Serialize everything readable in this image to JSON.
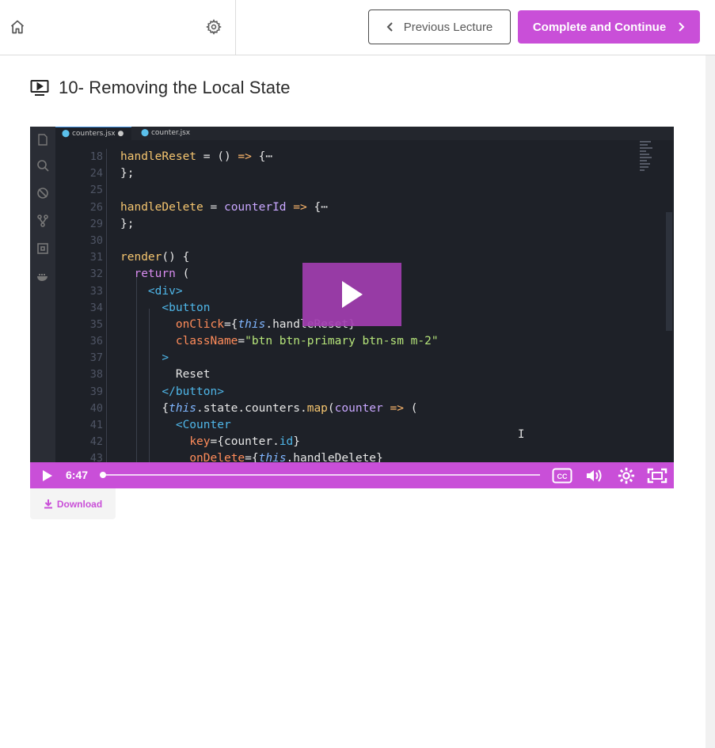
{
  "header": {
    "home_icon": "home-icon",
    "settings_icon": "gear-icon",
    "previous_label": "Previous Lecture",
    "complete_label": "Complete and Continue"
  },
  "lecture": {
    "title": "10- Removing the Local State",
    "title_icon": "video-lecture-icon"
  },
  "video": {
    "editor_tabs": [
      "counters.jsx",
      "counter.jsx"
    ],
    "line_numbers": [
      "18",
      "24",
      "25",
      "26",
      "29",
      "30",
      "31",
      "32",
      "33",
      "34",
      "35",
      "36",
      "37",
      "38",
      "39",
      "40",
      "41",
      "42",
      "43"
    ],
    "current_time": "6:47",
    "progress": 0.0,
    "controls": {
      "play_icon": "play-icon",
      "captions_icon": "cc-icon",
      "volume_icon": "volume-icon",
      "settings_icon": "settings-icon",
      "fullscreen_icon": "fullscreen-icon"
    }
  },
  "download": {
    "label": "Download",
    "icon": "download-icon"
  },
  "colors": {
    "accent": "#c94fd8",
    "play_overlay": "#a23eb0",
    "editor_bg": "#1e2128"
  }
}
